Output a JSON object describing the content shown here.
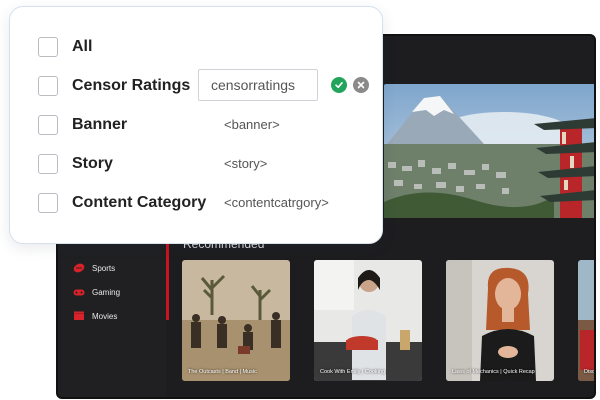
{
  "filter_panel": {
    "rows": [
      {
        "label": "All"
      },
      {
        "label": "Censor Ratings",
        "input_value": "censorratings"
      },
      {
        "label": "Banner",
        "tag": "<banner>"
      },
      {
        "label": "Story",
        "tag": "<story>"
      },
      {
        "label": "Content Category",
        "tag": "<contentcatrgory>"
      }
    ],
    "confirm_icon": "check-circle-icon",
    "cancel_icon": "close-circle-icon"
  },
  "app": {
    "sidebar": {
      "items": [
        {
          "label": "Sports",
          "icon": "sports-icon"
        },
        {
          "label": "Gaming",
          "icon": "gamepad-icon"
        },
        {
          "label": "Movies",
          "icon": "clapperboard-icon"
        }
      ]
    },
    "recommended_label": "Recommended",
    "cards": [
      {
        "caption": "The Outcasts | Band | Music"
      },
      {
        "caption": "Cook With Emily | Cooking"
      },
      {
        "caption": "Laws of Mechanics | Quick Recap"
      },
      {
        "caption": "Disc"
      }
    ],
    "accent_color": "#c8141e",
    "background_color": "#1d1d1f"
  }
}
